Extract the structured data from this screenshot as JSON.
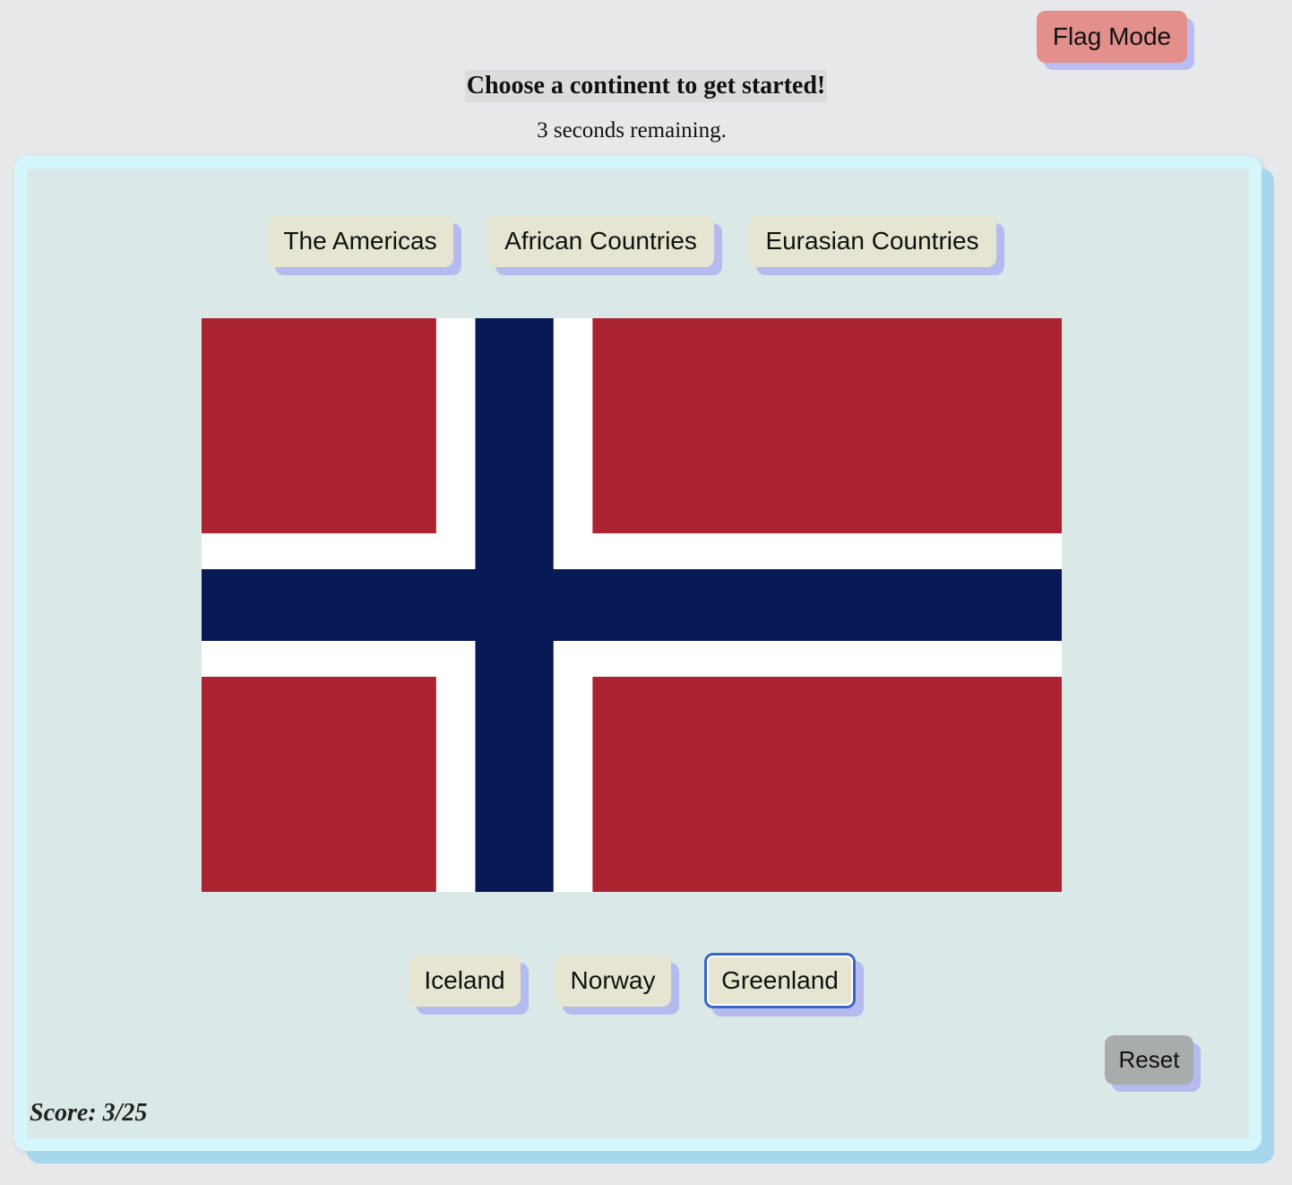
{
  "header": {
    "flag_mode_label": "Flag Mode",
    "title": "Choose a continent to get started!",
    "timer_text": "3 seconds remaining."
  },
  "continents": [
    {
      "label": "The Americas"
    },
    {
      "label": "African Countries"
    },
    {
      "label": "Eurasian Countries"
    }
  ],
  "flag": {
    "icon": "norway-flag",
    "colors": {
      "red": "#ab2231",
      "white": "#ffffff",
      "blue": "#071a55"
    }
  },
  "answers": [
    {
      "label": "Iceland"
    },
    {
      "label": "Norway"
    },
    {
      "label": "Greenland",
      "focused": true
    }
  ],
  "controls": {
    "reset_label": "Reset"
  },
  "score": {
    "text": "Score: 3/25"
  },
  "colors": {
    "background": "#e7e8ea",
    "panel": "#dae8e8",
    "panel_border": "#d5f7fb",
    "button": "#e5e5d1",
    "button_shadow": "#b5bbef",
    "flag_mode_button": "#e38f8c",
    "reset_button": "#a9acad",
    "focus_ring": "#3a66c6"
  }
}
